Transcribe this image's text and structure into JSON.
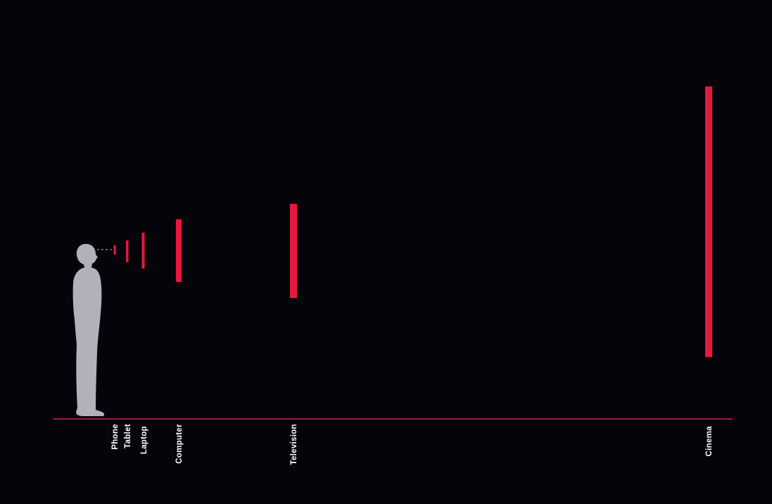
{
  "diagram": {
    "colors": {
      "background": "#05040b",
      "screen_bar": "#e8173f",
      "baseline": "#a3173a",
      "figure": "#b3b0bb",
      "label": "#ffffff"
    },
    "devices": [
      {
        "name": "Phone"
      },
      {
        "name": "Tablet"
      },
      {
        "name": "Laptop"
      },
      {
        "name": "Computer"
      },
      {
        "name": "Television"
      },
      {
        "name": "Cinema"
      }
    ]
  }
}
